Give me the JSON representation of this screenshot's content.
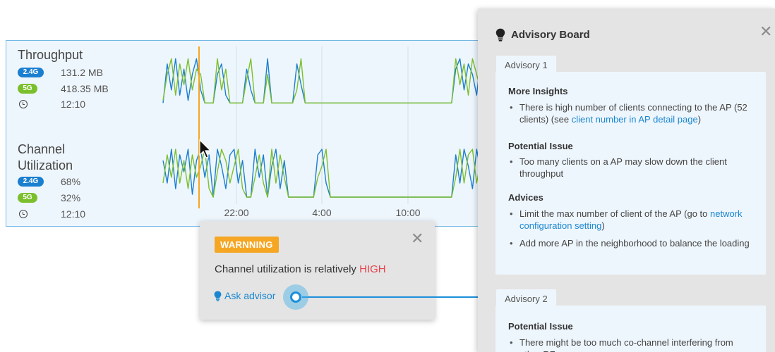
{
  "throughput": {
    "title": "Throughput",
    "band_24_label": "2.4G",
    "band_24_value": "131.2 MB",
    "band_5_label": "5G",
    "band_5_value": "418.35 MB",
    "time": "12:10"
  },
  "channel": {
    "title_line1": "Channel",
    "title_line2": "Utilization",
    "band_24_label": "2.4G",
    "band_24_value": "68%",
    "band_5_label": "5G",
    "band_5_value": "32%",
    "time": "12:10"
  },
  "time_axis": [
    "22:00",
    "4:00",
    "10:00"
  ],
  "colors": {
    "band_24": "#1b7fd0",
    "band_5": "#7bc02c",
    "marker": "#f5a623",
    "accent": "#1a86d0",
    "warning": "#e8414b"
  },
  "chart_data": [
    {
      "type": "line",
      "title": "Throughput",
      "series": [
        {
          "name": "2.4G",
          "values": [
            0.05,
            0.8,
            0.3,
            0.9,
            0.2,
            0.7,
            0.1,
            0.6,
            0.9,
            0.3,
            0.05,
            0.05,
            0.05,
            0.6,
            0.8,
            0.2,
            0.05,
            0.05,
            0.05,
            0.05,
            0.7,
            0.3,
            0.05,
            0.05,
            0.05,
            0.9,
            0.05,
            0.05,
            0.05,
            0.05,
            0.05,
            0.05,
            0.8,
            0.4,
            0.05,
            0.05,
            0.05,
            0.05,
            0.05,
            0.05,
            0.05,
            0.05,
            0.05,
            0.05,
            0.05,
            0.05,
            0.05,
            0.05,
            0.05,
            0.05,
            0.05,
            0.05,
            0.05,
            0.05,
            0.05,
            0.05,
            0.05,
            0.05,
            0.05,
            0.05,
            0.05,
            0.05,
            0.05,
            0.05,
            0.05,
            0.05,
            0.05,
            0.05,
            0.05,
            0.05,
            0.7,
            0.9,
            0.3,
            0.8,
            0.6,
            0.2,
            0.9,
            0.5,
            0.7,
            0.1
          ]
        },
        {
          "name": "5G",
          "values": [
            0.1,
            0.6,
            0.9,
            0.2,
            0.8,
            0.4,
            0.9,
            0.3,
            0.7,
            0.6,
            0.05,
            0.05,
            0.05,
            0.9,
            0.3,
            0.7,
            0.05,
            0.05,
            0.05,
            0.05,
            0.5,
            0.9,
            0.05,
            0.05,
            0.05,
            0.6,
            0.05,
            0.05,
            0.05,
            0.05,
            0.05,
            0.05,
            0.3,
            0.9,
            0.05,
            0.05,
            0.05,
            0.05,
            0.05,
            0.05,
            0.05,
            0.05,
            0.05,
            0.05,
            0.05,
            0.05,
            0.05,
            0.05,
            0.05,
            0.05,
            0.05,
            0.05,
            0.05,
            0.05,
            0.05,
            0.05,
            0.05,
            0.05,
            0.05,
            0.05,
            0.05,
            0.05,
            0.05,
            0.05,
            0.05,
            0.05,
            0.05,
            0.05,
            0.05,
            0.05,
            0.9,
            0.4,
            0.8,
            0.2,
            0.9,
            0.6,
            0.3,
            0.9,
            0.4,
            0.8
          ]
        }
      ]
    },
    {
      "type": "line",
      "title": "Channel Utilization",
      "series": [
        {
          "name": "2.4G",
          "values": [
            0.7,
            0.3,
            0.9,
            0.2,
            0.8,
            0.5,
            0.9,
            0.1,
            0.7,
            0.9,
            0.4,
            0.8,
            0.05,
            0.9,
            0.6,
            0.2,
            0.8,
            0.9,
            0.3,
            0.7,
            0.05,
            0.05,
            0.9,
            0.4,
            0.8,
            0.05,
            0.6,
            0.9,
            0.2,
            0.7,
            0.05,
            0.05,
            0.05,
            0.05,
            0.05,
            0.05,
            0.05,
            0.8,
            0.9,
            0.3,
            0.05,
            0.05,
            0.05,
            0.05,
            0.05,
            0.05,
            0.05,
            0.05,
            0.05,
            0.05,
            0.05,
            0.05,
            0.05,
            0.05,
            0.05,
            0.05,
            0.05,
            0.05,
            0.05,
            0.05,
            0.05,
            0.05,
            0.05,
            0.05,
            0.05,
            0.05,
            0.05,
            0.05,
            0.05,
            0.05,
            0.8,
            0.3,
            0.9,
            0.6,
            0.2,
            0.9,
            0.5,
            0.8,
            0.3,
            0.7
          ]
        },
        {
          "name": "5G",
          "values": [
            0.3,
            0.8,
            0.4,
            0.9,
            0.3,
            0.7,
            0.2,
            0.8,
            0.4,
            0.6,
            0.9,
            0.2,
            0.05,
            0.5,
            0.9,
            0.7,
            0.3,
            0.6,
            0.9,
            0.2,
            0.05,
            0.05,
            0.4,
            0.8,
            0.3,
            0.05,
            0.9,
            0.3,
            0.8,
            0.4,
            0.05,
            0.05,
            0.05,
            0.05,
            0.05,
            0.05,
            0.05,
            0.4,
            0.6,
            0.9,
            0.05,
            0.05,
            0.05,
            0.05,
            0.05,
            0.05,
            0.05,
            0.05,
            0.05,
            0.05,
            0.05,
            0.05,
            0.05,
            0.05,
            0.05,
            0.05,
            0.05,
            0.05,
            0.05,
            0.05,
            0.05,
            0.05,
            0.05,
            0.05,
            0.05,
            0.05,
            0.05,
            0.05,
            0.05,
            0.05,
            0.4,
            0.9,
            0.3,
            0.8,
            0.9,
            0.3,
            0.7,
            0.4,
            0.9,
            0.5
          ]
        }
      ]
    }
  ],
  "warning": {
    "badge": "WARNNING",
    "message": "Channel utilization is relatively ",
    "level": "HIGH",
    "ask_label": "Ask advisor"
  },
  "board": {
    "title": "Advisory Board",
    "advisory1": {
      "tab": "Advisory 1",
      "more_insights_title": "More Insights",
      "insight_text": "There is high number of clients connecting to the AP (52 clients) (see ",
      "insight_link": "client number in AP detail page",
      "insight_tail": ")",
      "potential_title": "Potential Issue",
      "potential_text": "Too many clients on a AP may slow down the client throughput",
      "advices_title": "Advices",
      "advice1_text": "Limit the max number of client of the AP (go to ",
      "advice1_link": "network configuration setting",
      "advice1_tail": ")",
      "advice2_text": "Add more AP in the neighborhood to balance the loading"
    },
    "advisory2": {
      "tab": "Advisory 2",
      "potential_title": "Potential Issue",
      "potential_text": "There might be too much co-channel interfering from other RF source"
    }
  }
}
